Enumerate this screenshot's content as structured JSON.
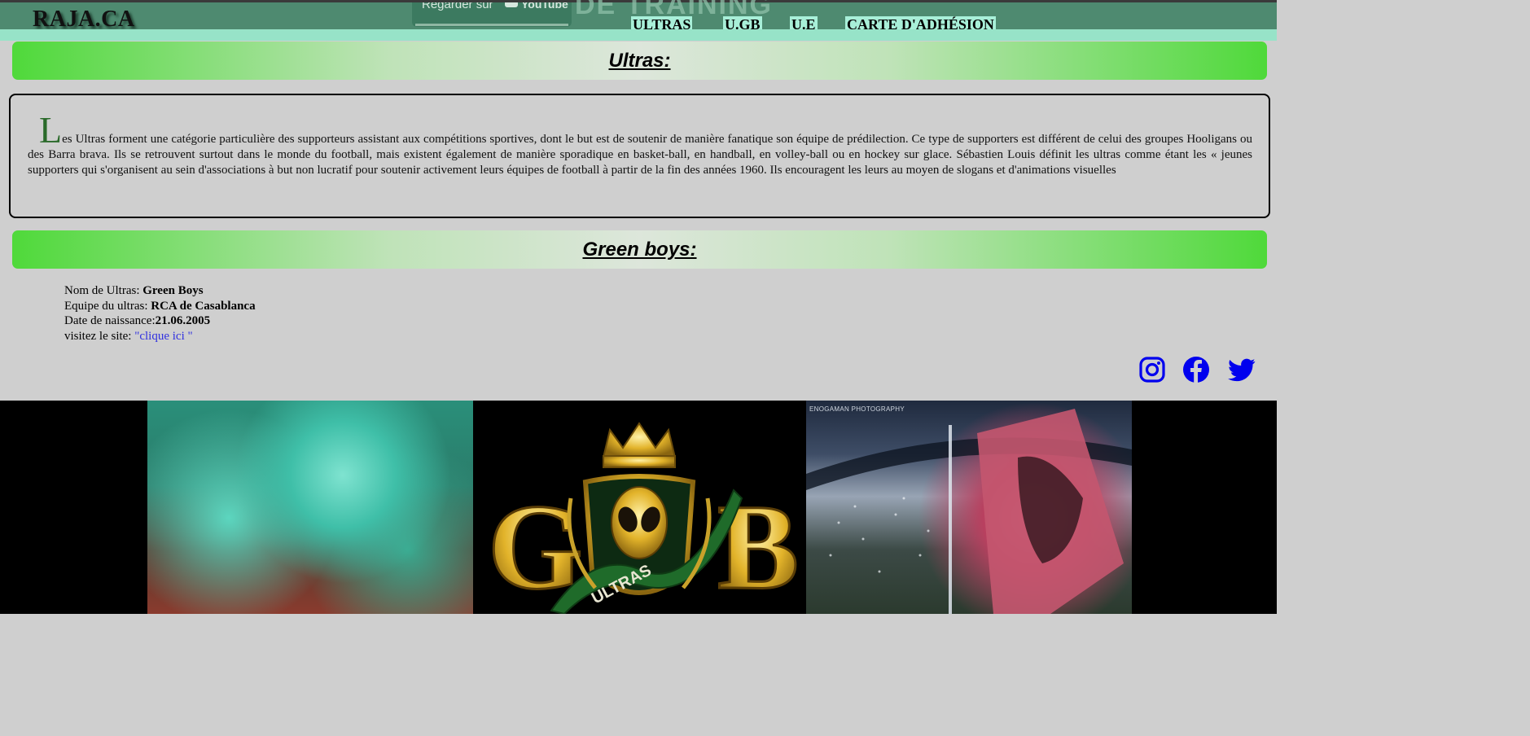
{
  "header": {
    "logo": "RAJA.CA",
    "video_overlay": {
      "watch_on": "Regarder sur",
      "platform": "YouTube",
      "title_fragment": "DE TRAINING"
    },
    "nav": [
      {
        "label": "ULTRAS"
      },
      {
        "label": "U.GB"
      },
      {
        "label": "U.E"
      },
      {
        "label": "CARTE D'ADHÉSION"
      }
    ]
  },
  "ultras_section": {
    "title": "Ultras:",
    "dropcap": "L",
    "paragraph": "es Ultras forment une catégorie particulière des supporteurs assistant aux compétitions sportives, dont le but est de soutenir de manière fanatique son équipe de prédilection. Ce type de supporters est différent de celui des groupes Hooligans ou des Barra brava. Ils se retrouvent surtout dans le monde du football, mais existent également de manière sporadique en basket-ball, en handball, en volley-ball ou en hockey sur glace. Sébastien Louis définit les ultras comme étant les « jeunes supporters qui s'organisent au sein d'associations à but non lucratif pour soutenir activement leurs équipes de football à partir de la fin des années 1960. Ils encouragent les leurs au moyen de slogans et d'animations visuelles"
  },
  "green_boys_section": {
    "title": "Green boys:",
    "info": {
      "name_label": "Nom de Ultras: ",
      "name_value": "Green Boys",
      "team_label": "Equipe du ultras: ",
      "team_value": "RCA de Casablanca",
      "birth_label": "Date de naissance:",
      "birth_value": "21.06.2005",
      "site_label": "visitez le site: ",
      "site_link": "\"clique ici \""
    }
  },
  "social": [
    {
      "icon": "instagram-icon",
      "color": "#0000ee"
    },
    {
      "icon": "facebook-icon",
      "color": "#0000ee"
    },
    {
      "icon": "twitter-icon",
      "color": "#0000ee"
    }
  ],
  "gallery": {
    "photo_3_caption": "ENOGAMAN PHOTOGRAPHY",
    "logo_letters": {
      "left": "G",
      "right": "B",
      "banner": "ULTRAS"
    }
  },
  "colors": {
    "header": "#4e8a70",
    "strip": "#97e3c8",
    "title_gradient_edge": "#4fd93a",
    "page_bg": "#cfcfcf",
    "link": "#3030e0",
    "dropcap": "#2a6a2a"
  }
}
